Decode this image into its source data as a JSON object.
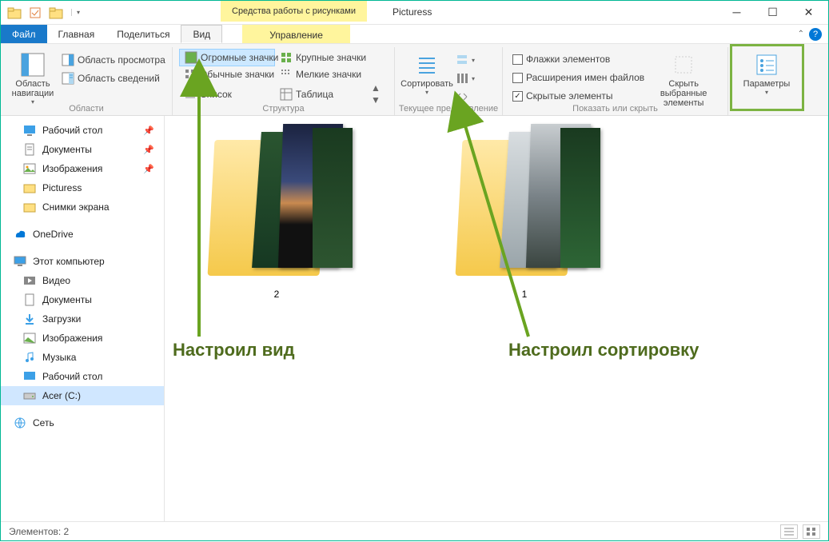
{
  "title": {
    "context_tab": "Средства работы с рисунками",
    "window_title": "Picturess"
  },
  "tabs": {
    "file": "Файл",
    "home": "Главная",
    "share": "Поделиться",
    "view": "Вид",
    "manage": "Управление"
  },
  "ribbon": {
    "panes": {
      "nav_pane": "Область навигации",
      "preview_pane": "Область просмотра",
      "details_pane": "Область сведений",
      "group_label": "Области"
    },
    "layout": {
      "extra_large": "Огромные значки",
      "large": "Крупные значки",
      "medium": "Обычные значки",
      "small": "Мелкие значки",
      "list": "Список",
      "table": "Таблица",
      "group_label": "Структура"
    },
    "current": {
      "sort": "Сортировать",
      "group_label": "Текущее представление"
    },
    "show_hide": {
      "checkboxes": "Флажки элементов",
      "extensions": "Расширения имен файлов",
      "hidden": "Скрытые элементы",
      "hide_selected": "Скрыть выбранные элементы",
      "group_label": "Показать или скрыть"
    },
    "options": {
      "label": "Параметры"
    }
  },
  "nav": {
    "quick": [
      {
        "label": "Рабочий стол",
        "pinned": true
      },
      {
        "label": "Документы",
        "pinned": true
      },
      {
        "label": "Изображения",
        "pinned": true
      },
      {
        "label": "Picturess",
        "pinned": false
      },
      {
        "label": "Снимки экрана",
        "pinned": false
      }
    ],
    "onedrive": "OneDrive",
    "this_pc": "Этот компьютер",
    "pc_items": [
      "Видео",
      "Документы",
      "Загрузки",
      "Изображения",
      "Музыка",
      "Рабочий стол",
      "Acer (C:)"
    ],
    "network": "Сеть"
  },
  "folders": [
    {
      "label": "2"
    },
    {
      "label": "1"
    }
  ],
  "annotations": {
    "view": "Настроил вид",
    "sort": "Настроил сортировку"
  },
  "statusbar": {
    "count_label": "Элементов: 2"
  }
}
